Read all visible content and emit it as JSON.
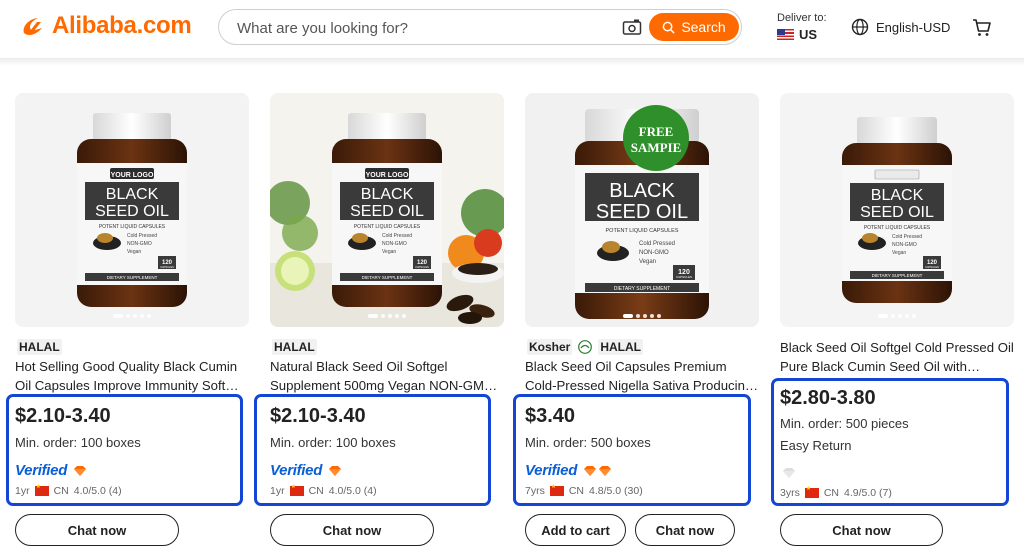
{
  "header": {
    "logo_text": "Alibaba.com",
    "search_placeholder": "What are you looking for?",
    "search_button": "Search",
    "deliver_label": "Deliver to:",
    "deliver_country": "US",
    "language": "English-USD",
    "accent_color": "#ff6a00"
  },
  "highlight_color": "#1446d6",
  "products": [
    {
      "badges": [
        "HALAL"
      ],
      "title": "Hot Selling Good Quality Black Cumin Oil Capsules Improve Immunity Soft Gel Capsules",
      "price": "$2.10-3.40",
      "min_order": "Min. order: 100 boxes",
      "verified": "Verified",
      "diamonds": 1,
      "years": "1yr",
      "country": "CN",
      "rating": "4.0/5.0 (4)",
      "image": {
        "label_logo": "YOUR LOGO",
        "label_line1": "BLACK",
        "label_line2": "SEED OIL",
        "sub": "POTENT LIQUID CAPSULES",
        "bullets": [
          "Cold Pressed",
          "NON-GMO",
          "Vegan"
        ],
        "count": "120",
        "count_sub": "CAPSULES",
        "footer": "DIETARY SUPPLEMENT"
      },
      "buttons": [
        "Chat now"
      ]
    },
    {
      "badges": [
        "HALAL"
      ],
      "title": "Natural Black Seed Oil Softgel Supplement 500mg Vegan NON-GMO Capsules",
      "price": "$2.10-3.40",
      "min_order": "Min. order: 100 boxes",
      "verified": "Verified",
      "diamonds": 1,
      "years": "1yr",
      "country": "CN",
      "rating": "4.0/5.0 (4)",
      "image": {
        "label_logo": "YOUR LOGO",
        "label_line1": "BLACK",
        "label_line2": "SEED OIL",
        "sub": "POTENT LIQUID CAPSULES",
        "bullets": [
          "Cold Pressed",
          "NON-GMO",
          "Vegan"
        ],
        "count": "120",
        "count_sub": "CAPSULES",
        "footer": "DIETARY SUPPLEMENT"
      },
      "buttons": [
        "Chat now"
      ]
    },
    {
      "badges": [
        "Kosher",
        "HALAL"
      ],
      "title": "Black Seed Oil Capsules Premium Cold-Pressed Nigella Sativa Producing Pure Black Cumin",
      "price": "$3.40",
      "min_order": "Min. order: 500 boxes",
      "verified": "Verified",
      "diamonds": 2,
      "years": "7yrs",
      "country": "CN",
      "rating": "4.8/5.0 (30)",
      "image": {
        "free_line1": "FREE",
        "free_line2": "SAMPIE",
        "label_line1": "BLACK",
        "label_line2": "SEED OIL",
        "sub": "POTENT LIQUID CAPSULES",
        "bullets": [
          "Cold Pressed",
          "NON-GMO",
          "Vegan"
        ],
        "count": "120",
        "count_sub": "CAPSULES",
        "footer": "DIETARY SUPPLEMENT"
      },
      "buttons": [
        "Add to cart",
        "Chat now"
      ]
    },
    {
      "badges": [],
      "title": "Black Seed Oil Softgel Cold Pressed Oil Pure Black Cumin Seed Oil with Vitamin E",
      "price": "$2.80-3.80",
      "min_order": "Min. order: 500 pieces",
      "easy_return": "Easy Return",
      "diamonds": 1,
      "years": "3yrs",
      "country": "CN",
      "rating": "4.9/5.0 (7)",
      "image": {
        "label_line1": "BLACK",
        "label_line2": "SEED OIL",
        "sub": "POTENT LIQUID CAPSULES",
        "bullets": [
          "Cold Pressed",
          "NON-GMO",
          "Vegan"
        ],
        "count": "120",
        "count_sub": "CAPSULES",
        "footer": "DIETARY SUPPLEMENT"
      },
      "buttons": [
        "Chat now"
      ]
    }
  ]
}
